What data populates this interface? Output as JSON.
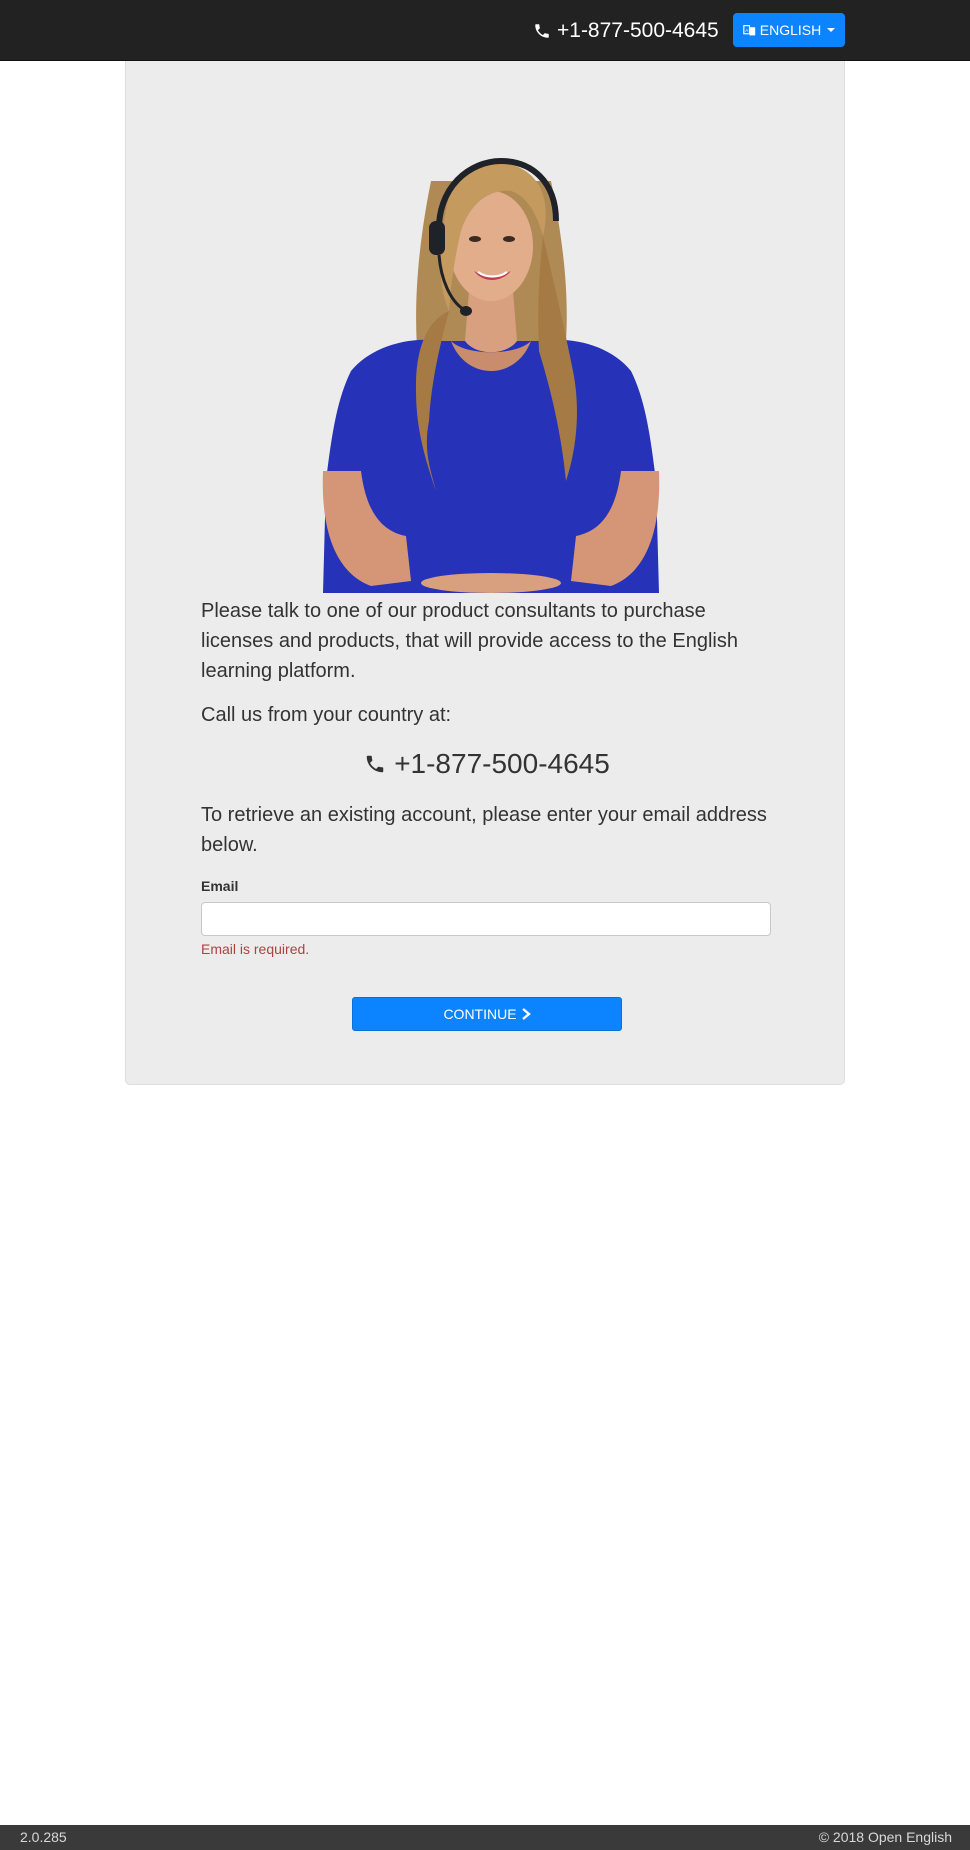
{
  "header": {
    "phone": "+1-877-500-4645",
    "phone_icon": "phone-icon",
    "language_button": {
      "label": "ENGLISH",
      "icon": "language-icon"
    }
  },
  "main": {
    "hero_image": "customer-support-agent-photo",
    "intro_text": "Please talk to one of our product consultants to purchase licenses and products, that will provide access to the English learning platform.",
    "call_text": "Call us from your country at:",
    "phone": "+1-877-500-4645",
    "retrieve_text": "To retrieve an existing account, please enter your email address below.",
    "email": {
      "label": "Email",
      "value": "",
      "placeholder": "",
      "error": "Email is required."
    },
    "continue_button": {
      "label": "CONTINUE",
      "icon": "chevron-right-icon"
    }
  },
  "footer": {
    "version": "2.0.285",
    "copyright": "© 2018 Open English"
  },
  "colors": {
    "navbar_bg": "#222222",
    "accent": "#0d84ff",
    "panel_bg": "#ececec",
    "error": "#a94442",
    "footer_bg": "#3a3a3a"
  }
}
